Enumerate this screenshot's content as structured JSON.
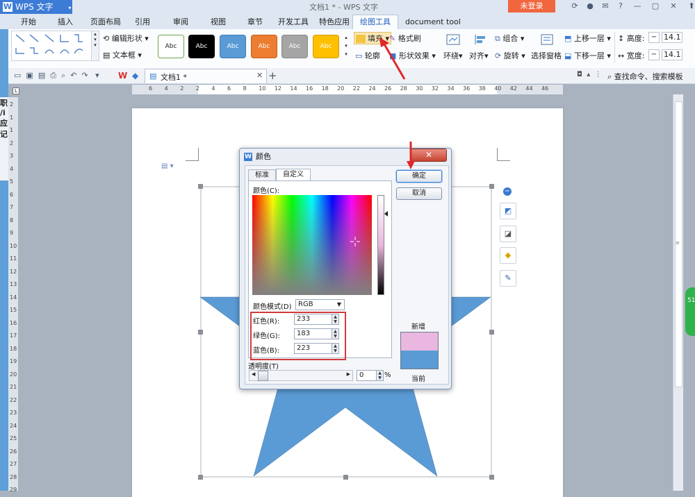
{
  "app": {
    "logo_text": "WPS 文字",
    "window_title": "文档1 * - WPS 文字",
    "login_button": "未登录"
  },
  "menu_tabs": [
    "开始",
    "插入",
    "页面布局",
    "引用",
    "审阅",
    "视图",
    "章节",
    "开发工具",
    "特色应用",
    "绘图工具",
    "document tool"
  ],
  "active_tab": "绘图工具",
  "ribbon": {
    "edit_shape": "编辑形状",
    "text_box": "文本框",
    "style_sample_label": "Abc",
    "style_colors": [
      "#ffffff",
      "#000000",
      "#5b9bd5",
      "#ed7d31",
      "#a5a5a5",
      "#ffc000"
    ],
    "fill": "填充",
    "format_painter": "格式刷",
    "outline": "轮廓",
    "shape_effects": "形状效果",
    "wrap": "环绕",
    "align": "对齐",
    "group": "组合",
    "rotate": "旋转",
    "selection_pane": "选择窗格",
    "bring_forward": "上移一层",
    "send_backward": "下移一层",
    "height_label": "高度:",
    "width_label": "宽度:",
    "height_value": "14.1",
    "width_value": "14.1"
  },
  "quick_access": {
    "doc_tab": "文档1 *",
    "search": "查找命令、搜索模板"
  },
  "ruler": {
    "h_ticks": [
      "6",
      "4",
      "2",
      "2",
      "4",
      "6",
      "8",
      "10",
      "12",
      "14",
      "16",
      "18",
      "20",
      "22",
      "24",
      "26",
      "28",
      "30",
      "32",
      "34",
      "36",
      "38",
      "40",
      "42",
      "44",
      "46"
    ],
    "v_ticks": [
      "2",
      "1",
      "1",
      "2",
      "3",
      "4",
      "5",
      "6",
      "7",
      "8",
      "9",
      "10",
      "11",
      "12",
      "13",
      "14",
      "15",
      "16",
      "17",
      "18",
      "19",
      "20",
      "21",
      "22",
      "23",
      "24",
      "25",
      "26",
      "27",
      "28",
      "29"
    ]
  },
  "sidebar_text": [
    "职",
    "/i",
    "应",
    "记"
  ],
  "dialog": {
    "title": "颜色",
    "tab_standard": "标准",
    "tab_custom": "自定义",
    "color_label": "颜色(C):",
    "mode_label": "颜色模式(D)",
    "mode_value": "RGB",
    "red_label": "红色(R):",
    "green_label": "绿色(G):",
    "blue_label": "蓝色(B):",
    "red": "233",
    "green": "183",
    "blue": "223",
    "opacity_label": "透明度(T)",
    "opacity_value": "0",
    "opacity_unit": "%",
    "ok": "确定",
    "cancel": "取消",
    "new_label": "新增",
    "current_label": "当前",
    "new_color": "#e9b7df",
    "current_color": "#5b9bd5"
  },
  "shape": {
    "fill_color": "#5b9bd5"
  },
  "right_badge": "51"
}
